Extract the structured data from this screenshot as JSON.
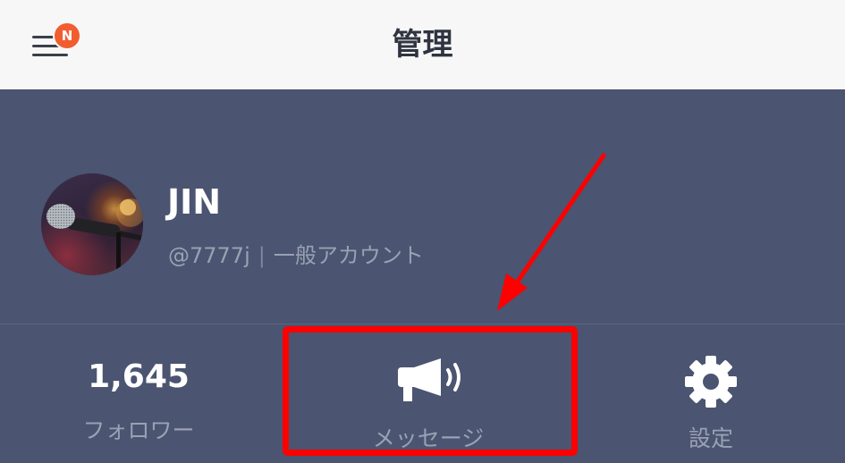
{
  "header": {
    "title": "管理",
    "menu_badge": "N"
  },
  "profile": {
    "name": "JIN",
    "handle": "@7777j",
    "separator": "|",
    "account_type": "一般アカウント"
  },
  "stats": {
    "followers_count": "1,645",
    "followers_label": "フォロワー",
    "message_label": "メッセージ",
    "message_icon": "megaphone-icon",
    "settings_label": "設定",
    "settings_icon": "gear-icon"
  },
  "colors": {
    "header_bg": "#f7f7f7",
    "panel_bg": "#4b5470",
    "badge": "#f25d2f",
    "annotation": "#ff0000"
  }
}
